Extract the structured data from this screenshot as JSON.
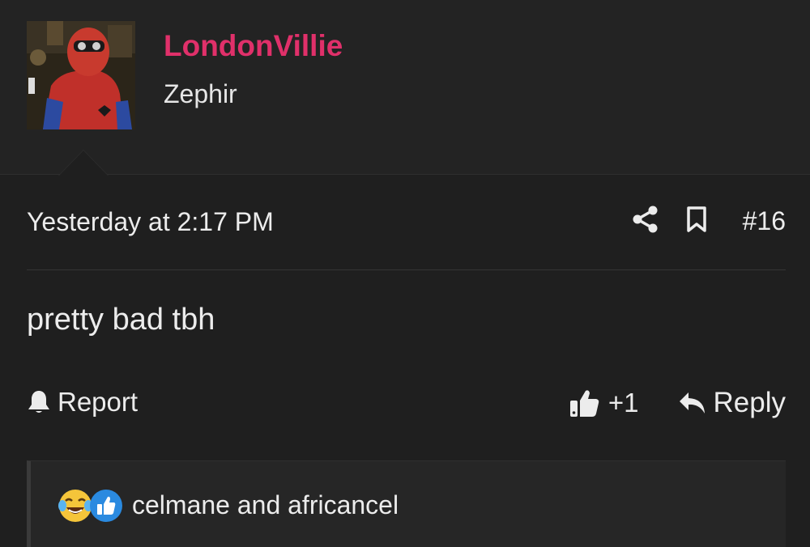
{
  "user": {
    "name": "LondonVillie",
    "title": "Zephir",
    "name_color": "#e0306a"
  },
  "post": {
    "timestamp": "Yesterday at 2:17 PM",
    "number": "#16",
    "body": "pretty bad tbh"
  },
  "actions": {
    "report_label": "Report",
    "like_label": "+1",
    "reply_label": "Reply"
  },
  "reactions": {
    "icons": [
      "laughing-tears-icon",
      "thumbs-up-icon"
    ],
    "text": "celmane and africancel"
  },
  "icons": {
    "share": "share-icon",
    "bookmark": "bookmark-icon",
    "report": "bell-icon",
    "like": "thumbs-up-icon",
    "reply": "reply-arrow-icon"
  }
}
